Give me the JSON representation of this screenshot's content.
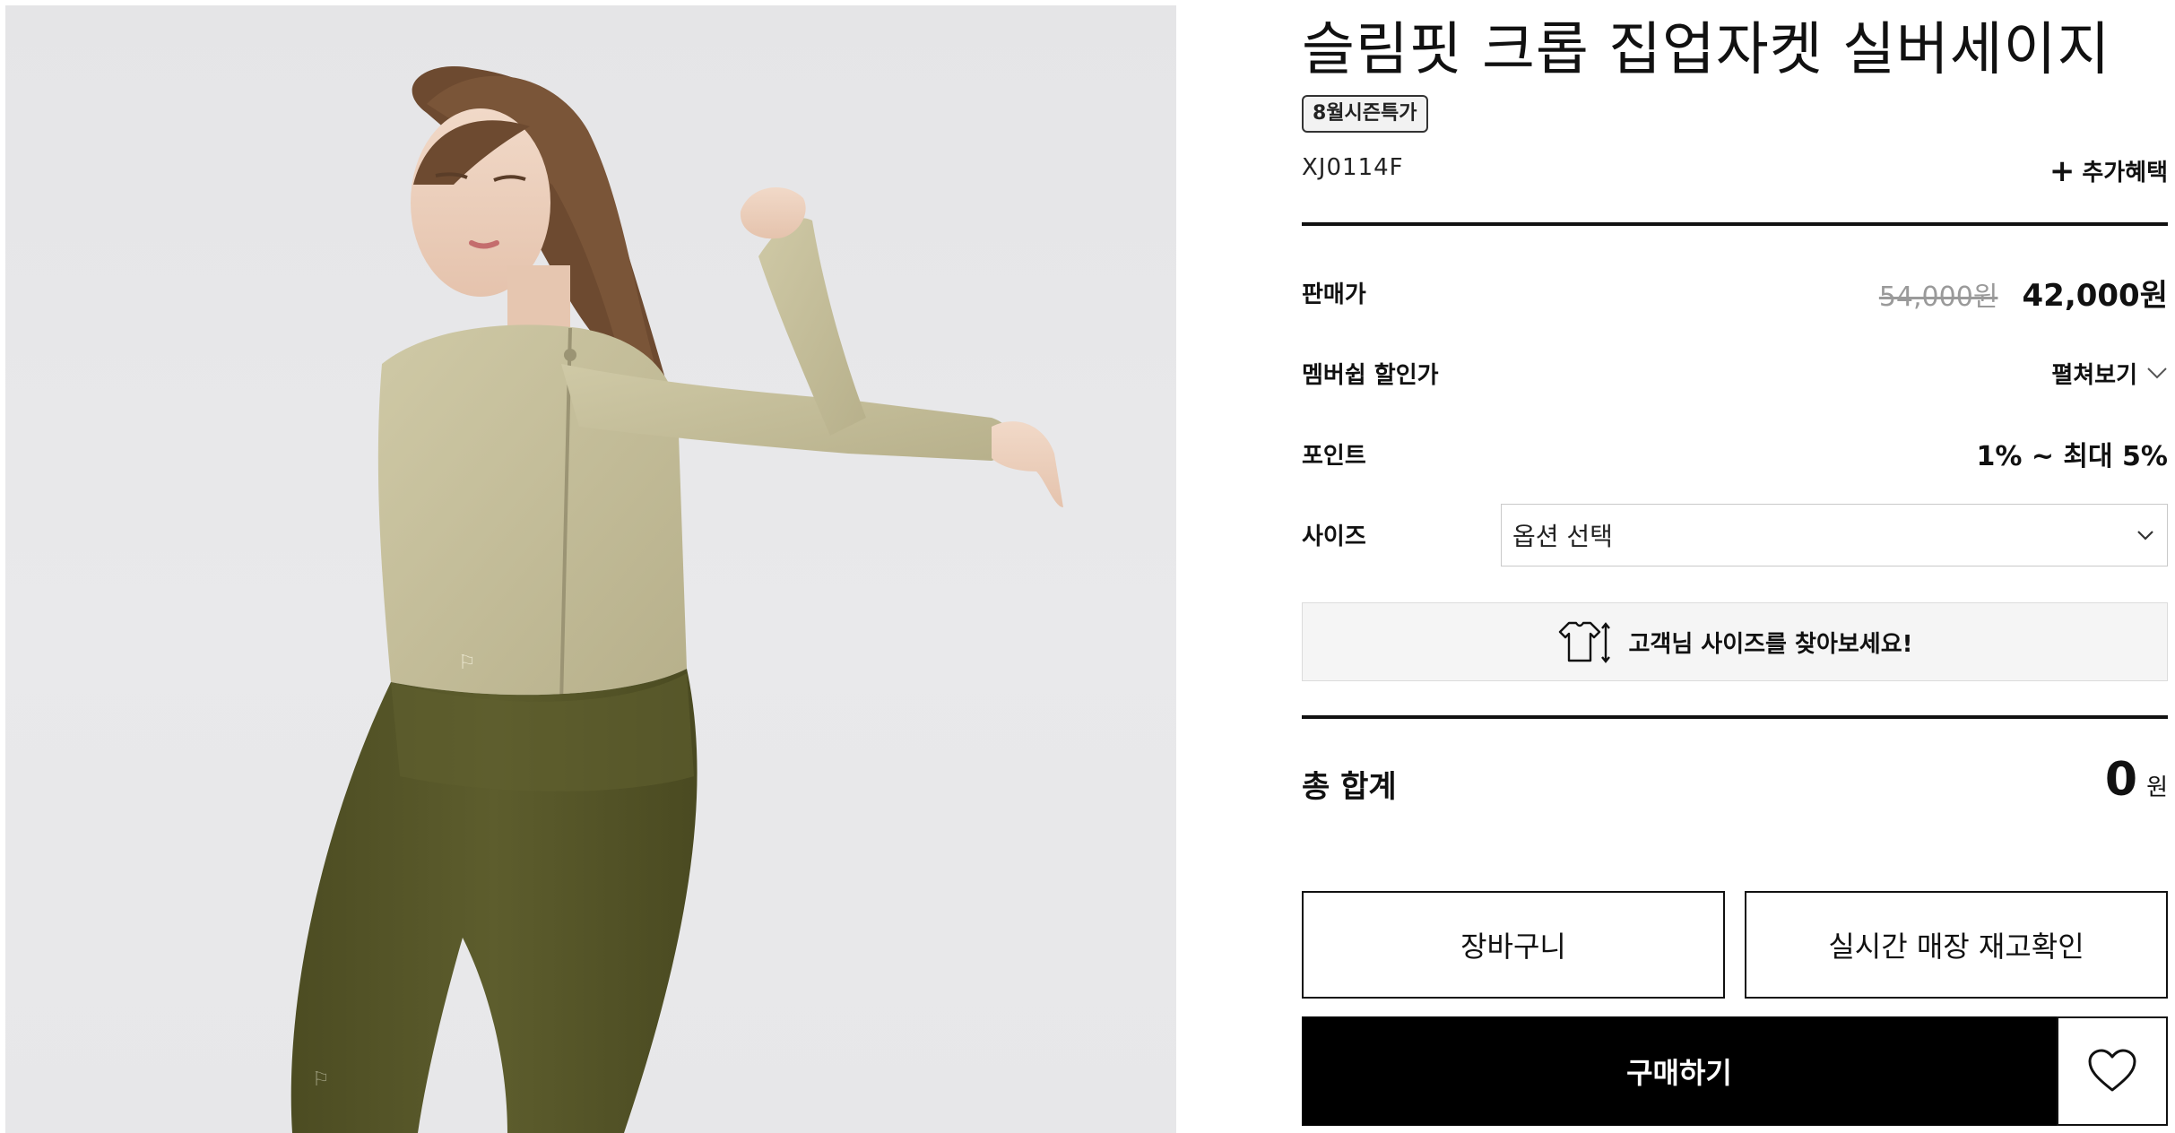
{
  "product": {
    "image_alt": "슬림핏 크롭 집업자켓 실버세이지 착용 모델 이미지",
    "title": "슬림핏 크롭 집업자켓 실버세이지",
    "badge": "8월시즌특가",
    "code": "XJ0114F",
    "extra_benefit": "추가혜택"
  },
  "pricing": {
    "price_label": "판매가",
    "original_price": "54,000원",
    "sale_price": "42,000원",
    "member_label": "멤버쉽 할인가",
    "member_toggle": "펼쳐보기",
    "point_label": "포인트",
    "point_value": "1% ~ 최대 5%"
  },
  "size": {
    "label": "사이즈",
    "select_value": "옵션 선택",
    "finder_text": "고객님 사이즈를 찾아보세요!"
  },
  "total": {
    "label": "총 합계",
    "value": "0",
    "unit": "원"
  },
  "actions": {
    "cart": "장바구니",
    "stock_check": "실시간 매장 재고확인",
    "buy": "구매하기"
  },
  "colors": {
    "jacket": "#c8c29e",
    "leggings": "#58582a",
    "hair": "#6d4a30",
    "accent": "#000000"
  },
  "icons": [
    "chevron-down-icon",
    "tshirt-size-icon",
    "heart-icon",
    "plus-icon"
  ]
}
